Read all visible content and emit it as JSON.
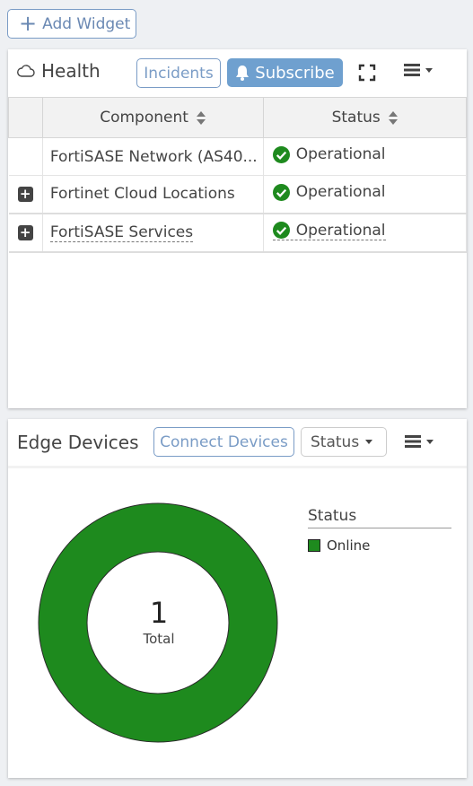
{
  "toolbar": {
    "add_widget_label": "Add Widget"
  },
  "health": {
    "title": "Health",
    "incidents_label": "Incidents",
    "subscribe_label": "Subscribe",
    "columns": {
      "component": "Component",
      "status": "Status"
    },
    "rows": [
      {
        "component": "FortiSASE Network (AS40...",
        "status": "Operational"
      },
      {
        "component": "Fortinet Cloud Locations",
        "status": "Operational"
      },
      {
        "component": "FortiSASE Services",
        "status": "Operational"
      }
    ]
  },
  "edge": {
    "title": "Edge Devices",
    "connect_label": "Connect Devices",
    "status_dropdown": "Status",
    "total_value": "1",
    "total_label": "Total",
    "legend_title": "Status",
    "legend_items": [
      {
        "label": "Online",
        "color": "#1e8a1e"
      }
    ]
  },
  "chart_data": {
    "type": "pie",
    "categories": [
      "Online"
    ],
    "values": [
      1
    ],
    "title": "",
    "total": 1
  },
  "colors": {
    "accent": "#6fa0cf",
    "ok": "#1e8a1e",
    "online": "#1e8a1e"
  }
}
